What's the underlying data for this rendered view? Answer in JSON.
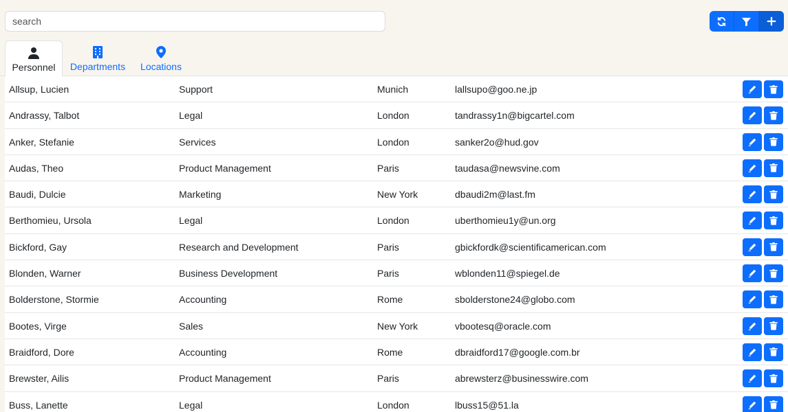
{
  "search": {
    "placeholder": "search",
    "value": ""
  },
  "toolbar": {
    "buttons": [
      "refresh-icon",
      "filter-icon",
      "plus-icon"
    ]
  },
  "tabs": [
    {
      "label": "Personnel",
      "icon": "person-icon",
      "active": true
    },
    {
      "label": "Departments",
      "icon": "building-icon",
      "active": false
    },
    {
      "label": "Locations",
      "icon": "map-pin-icon",
      "active": false
    }
  ],
  "colors": {
    "accent": "#0d6efd",
    "background": "#f8f5ef"
  },
  "rows": [
    {
      "name": "Allsup, Lucien",
      "department": "Support",
      "location": "Munich",
      "email": "lallsupo@goo.ne.jp"
    },
    {
      "name": "Andrassy, Talbot",
      "department": "Legal",
      "location": "London",
      "email": "tandrassy1n@bigcartel.com"
    },
    {
      "name": "Anker, Stefanie",
      "department": "Services",
      "location": "London",
      "email": "sanker2o@hud.gov"
    },
    {
      "name": "Audas, Theo",
      "department": "Product Management",
      "location": "Paris",
      "email": "taudasa@newsvine.com"
    },
    {
      "name": "Baudi, Dulcie",
      "department": "Marketing",
      "location": "New York",
      "email": "dbaudi2m@last.fm"
    },
    {
      "name": "Berthomieu, Ursola",
      "department": "Legal",
      "location": "London",
      "email": "uberthomieu1y@un.org"
    },
    {
      "name": "Bickford, Gay",
      "department": "Research and Development",
      "location": "Paris",
      "email": "gbickfordk@scientificamerican.com"
    },
    {
      "name": "Blonden, Warner",
      "department": "Business Development",
      "location": "Paris",
      "email": "wblonden11@spiegel.de"
    },
    {
      "name": "Bolderstone, Stormie",
      "department": "Accounting",
      "location": "Rome",
      "email": "sbolderstone24@globo.com"
    },
    {
      "name": "Bootes, Virge",
      "department": "Sales",
      "location": "New York",
      "email": "vbootesq@oracle.com"
    },
    {
      "name": "Braidford, Dore",
      "department": "Accounting",
      "location": "Rome",
      "email": "dbraidford17@google.com.br"
    },
    {
      "name": "Brewster, Ailis",
      "department": "Product Management",
      "location": "Paris",
      "email": "abrewsterz@businesswire.com"
    },
    {
      "name": "Buss, Lanette",
      "department": "Legal",
      "location": "London",
      "email": "lbuss15@51.la"
    }
  ]
}
